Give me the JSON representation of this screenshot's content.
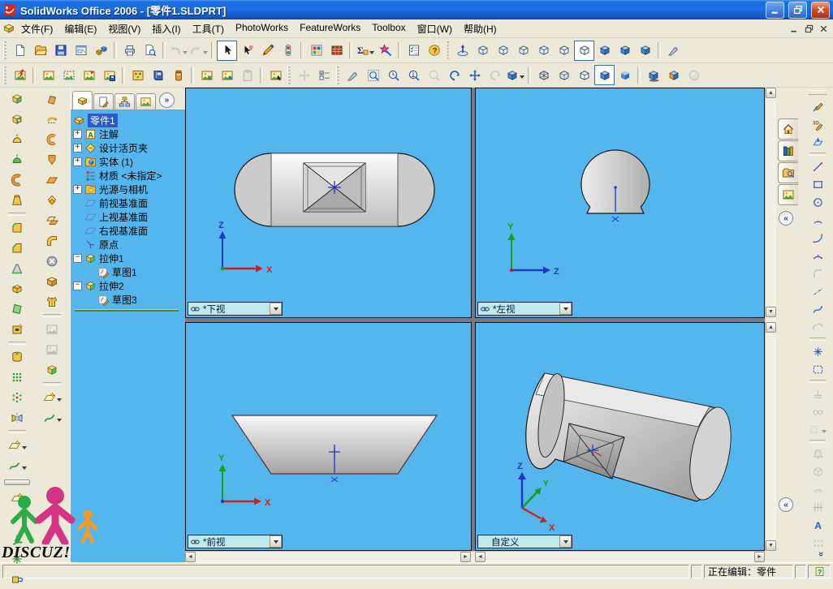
{
  "colors": {
    "viewport_bg": "#55b6ee",
    "titlebar_blue": "#1b6be0",
    "toolbar_bg": "#ece9d8",
    "selection_blue": "#2a5cc8",
    "combo_bg": "#c2e8ea",
    "axis_red": "#cc2020",
    "axis_green": "#15a015",
    "axis_blue": "#2233cc"
  },
  "titlebar": {
    "title": "SolidWorks Office 2006 - [零件1.SLDPRT]"
  },
  "menubar": {
    "items": [
      {
        "id": "file",
        "label": "文件(F)"
      },
      {
        "id": "edit",
        "label": "编辑(E)"
      },
      {
        "id": "view",
        "label": "视图(V)"
      },
      {
        "id": "insert",
        "label": "插入(I)"
      },
      {
        "id": "tools",
        "label": "工具(T)"
      },
      {
        "id": "photoworks",
        "label": "PhotoWorks"
      },
      {
        "id": "featureworks",
        "label": "FeatureWorks"
      },
      {
        "id": "toolbox",
        "label": "Toolbox"
      },
      {
        "id": "window",
        "label": "窗口(W)"
      },
      {
        "id": "help",
        "label": "帮助(H)"
      }
    ]
  },
  "toolbar_row1": [
    {
      "grip": true
    },
    {
      "id": "new-document",
      "g": "page"
    },
    {
      "id": "open-document",
      "g": "folder"
    },
    {
      "id": "save",
      "g": "floppy"
    },
    {
      "id": "make-drawing-from-part",
      "g": "drawing"
    },
    {
      "id": "make-assembly-from-part",
      "g": "assembly"
    },
    {
      "sep": true
    },
    {
      "id": "print",
      "g": "printer"
    },
    {
      "id": "print-preview",
      "g": "preview"
    },
    {
      "sep": true
    },
    {
      "id": "undo",
      "g": "undo",
      "dd": true,
      "disabled": true
    },
    {
      "id": "redo",
      "g": "redo",
      "dd": true,
      "disabled": true
    },
    {
      "sep": true
    },
    {
      "id": "select",
      "g": "cursor",
      "active": true
    },
    {
      "id": "select-other",
      "g": "cursor2"
    },
    {
      "id": "sketch-toggle",
      "g": "pencil"
    },
    {
      "id": "rebuild",
      "g": "traffic"
    },
    {
      "sep": true
    },
    {
      "id": "edit-color",
      "g": "palette"
    },
    {
      "id": "edit-texture",
      "g": "bricks"
    },
    {
      "sep": true
    },
    {
      "id": "design-table",
      "g": "sigma",
      "dd": true
    },
    {
      "id": "photoworks-wizard",
      "g": "wizard"
    },
    {
      "sep": true
    },
    {
      "id": "options",
      "g": "checklist"
    },
    {
      "id": "help",
      "g": "help"
    },
    {
      "grip": true
    },
    {
      "id": "normal-to",
      "g": "normalto"
    },
    {
      "id": "front-view",
      "g": "cubew"
    },
    {
      "id": "back-view",
      "g": "cubew"
    },
    {
      "id": "left-view",
      "g": "cubew"
    },
    {
      "id": "right-view",
      "g": "cubew"
    },
    {
      "id": "top-view",
      "g": "cubew"
    },
    {
      "id": "bottom-view",
      "g": "cubew",
      "active": true
    },
    {
      "id": "isometric-view",
      "g": "cubes"
    },
    {
      "id": "trimetric-view",
      "g": "cubes"
    },
    {
      "id": "dimetric-view",
      "g": "cubes"
    },
    {
      "sep": true
    },
    {
      "id": "measure",
      "g": "probe"
    }
  ],
  "toolbar_row2": [
    {
      "grip": true
    },
    {
      "id": "photoworks-render",
      "g": "render"
    },
    {
      "sep": true
    },
    {
      "id": "render-area",
      "g": "photo"
    },
    {
      "id": "render-selection",
      "g": "photodash"
    },
    {
      "id": "render-last",
      "g": "photoarrow"
    },
    {
      "id": "render-to-file",
      "g": "photosave"
    },
    {
      "sep": true
    },
    {
      "id": "scene-editor",
      "g": "scene"
    },
    {
      "id": "material-editor",
      "g": "book"
    },
    {
      "id": "texture-editor",
      "g": "jar"
    },
    {
      "sep": true
    },
    {
      "id": "copy-render-settings",
      "g": "photocut"
    },
    {
      "id": "duplicate-render",
      "g": "photoplus"
    },
    {
      "id": "paste-render-settings",
      "g": "paste",
      "disabled": true
    },
    {
      "sep": true
    },
    {
      "id": "photoworks-options",
      "g": "photocursor"
    },
    {
      "grip": true
    },
    {
      "id": "motion-trace",
      "g": "grayarrows",
      "disabled": true
    },
    {
      "id": "animation-options",
      "g": "animopts"
    },
    {
      "grip": true
    },
    {
      "id": "reference-probe",
      "g": "probe"
    },
    {
      "id": "zoom-to-fit",
      "g": "zoomfit"
    },
    {
      "id": "zoom-to-area",
      "g": "zoomwin"
    },
    {
      "id": "zoom-in-out",
      "g": "zoomio"
    },
    {
      "id": "zoom-to-selection",
      "g": "zoomsel",
      "disabled": true
    },
    {
      "id": "rotate-view",
      "g": "rotview"
    },
    {
      "id": "pan",
      "g": "pan"
    },
    {
      "id": "rotate-about-scene-floor",
      "g": "rotgray",
      "disabled": true
    },
    {
      "id": "view-orientation",
      "g": "cubes",
      "dd": true
    },
    {
      "sep": true
    },
    {
      "id": "wireframe",
      "g": "dwire"
    },
    {
      "id": "hidden-lines-visible",
      "g": "dhlv"
    },
    {
      "id": "hidden-lines-removed",
      "g": "dhlr"
    },
    {
      "id": "shaded-with-edges",
      "g": "dse",
      "active": true
    },
    {
      "id": "shaded",
      "g": "dsh"
    },
    {
      "sep": true
    },
    {
      "id": "shadows-in-shaded-mode",
      "g": "dshadow"
    },
    {
      "id": "section-view",
      "g": "dsection"
    },
    {
      "id": "realview",
      "g": "sphere",
      "disabled": true
    }
  ],
  "left_toolbar_features": [
    {
      "id": "extruded-boss",
      "g": "fext"
    },
    {
      "id": "extruded-cut",
      "g": "fcut"
    },
    {
      "id": "revolved-boss",
      "g": "frev"
    },
    {
      "id": "revolved-cut",
      "g": "frevg"
    },
    {
      "id": "swept-boss",
      "g": "fsweep"
    },
    {
      "id": "lofted-boss",
      "g": "floft"
    },
    {
      "sep": true
    },
    {
      "id": "fillet",
      "g": "ffillet"
    },
    {
      "id": "chamfer",
      "g": "fchamfer"
    },
    {
      "id": "rib",
      "g": "frib"
    },
    {
      "id": "shell",
      "g": "fshell"
    },
    {
      "id": "draft",
      "g": "fdraft"
    },
    {
      "id": "hole-wizard",
      "g": "fhole"
    },
    {
      "sep": true
    },
    {
      "id": "wrap",
      "g": "fwrap"
    },
    {
      "id": "linear-pattern",
      "g": "fpat"
    },
    {
      "id": "circular-pattern",
      "g": "fcpat"
    },
    {
      "id": "mirror",
      "g": "fmirror"
    },
    {
      "sep": true
    },
    {
      "id": "reference-geometry",
      "g": "fplane",
      "dd": true
    },
    {
      "id": "curves",
      "g": "fcurve",
      "dd": true
    }
  ],
  "left_toolbar_surfaces": [
    {
      "id": "extruded-surface",
      "g": "sext"
    },
    {
      "id": "revolved-surface",
      "g": "srev"
    },
    {
      "id": "swept-surface",
      "g": "ssweep"
    },
    {
      "id": "lofted-surface",
      "g": "sloft"
    },
    {
      "id": "planar-surface",
      "g": "splanar"
    },
    {
      "id": "offset-surface",
      "g": "soffset"
    },
    {
      "id": "mid-surface",
      "g": "smid"
    },
    {
      "id": "filled-surface",
      "g": "selbow"
    },
    {
      "id": "delete-face",
      "g": "sdelface"
    },
    {
      "id": "untrim-surface",
      "g": "suntrim"
    },
    {
      "id": "thicken",
      "g": "svest"
    },
    {
      "sep": true
    },
    {
      "id": "extend-surface",
      "g": "photo",
      "disabled": true
    },
    {
      "id": "trim-surface",
      "g": "photo",
      "disabled": true
    },
    {
      "id": "replace-face",
      "g": "fext"
    },
    {
      "sep": true
    },
    {
      "id": "surface-reference-geometry",
      "g": "fplane",
      "dd": true
    },
    {
      "id": "surface-curves",
      "g": "fcurve",
      "dd": true
    }
  ],
  "left_toolbar_reference": [
    {
      "id": "reference-plane",
      "g": "fplane"
    },
    {
      "id": "reference-axis",
      "g": "faxis"
    },
    {
      "id": "coordinate-system",
      "g": "fcoord"
    },
    {
      "id": "reference-point",
      "g": "fpoint"
    },
    {
      "id": "mate-reference",
      "g": "fmate"
    }
  ],
  "feature_tree": {
    "tabs": [
      {
        "id": "featuremanager",
        "g": "tpart",
        "active": true
      },
      {
        "id": "propertymanager",
        "g": "propmgr"
      },
      {
        "id": "configurationmanager",
        "g": "cfgmgr"
      },
      {
        "id": "photoworks-items",
        "g": "photo"
      }
    ],
    "overflow_glyph": "»",
    "root_label": "零件1",
    "items": [
      {
        "id": "annotations",
        "label": "注解",
        "icon": "tann",
        "exp": "+",
        "lvl": 1
      },
      {
        "id": "design-binder",
        "label": "设计活页夹",
        "icon": "tbinder",
        "exp": "+",
        "lvl": 1
      },
      {
        "id": "solid-bodies",
        "label": "实体 (1)",
        "icon": "tsolids",
        "exp": "+",
        "lvl": 1
      },
      {
        "id": "material",
        "label": "材质 <未指定>",
        "icon": "tmat",
        "exp": "",
        "lvl": 1
      },
      {
        "id": "lights-cameras",
        "label": "光源与相机",
        "icon": "tlights",
        "exp": "+",
        "lvl": 1
      },
      {
        "id": "front-plane",
        "label": "前视基准面",
        "icon": "tplane",
        "exp": "",
        "lvl": 1
      },
      {
        "id": "top-plane",
        "label": "上视基准面",
        "icon": "tplane",
        "exp": "",
        "lvl": 1
      },
      {
        "id": "right-plane",
        "label": "右视基准面",
        "icon": "tplane",
        "exp": "",
        "lvl": 1
      },
      {
        "id": "origin",
        "label": "原点",
        "icon": "torigin",
        "exp": "",
        "lvl": 1
      },
      {
        "id": "extrude1",
        "label": "拉伸1",
        "icon": "fext",
        "exp": "-",
        "lvl": 1
      },
      {
        "id": "sketch1",
        "label": "草图1",
        "icon": "tsketch",
        "exp": "",
        "lvl": 2
      },
      {
        "id": "extrude2",
        "label": "拉伸2",
        "icon": "fext",
        "exp": "-",
        "lvl": 1
      },
      {
        "id": "sketch3",
        "label": "草图3",
        "icon": "tsketch",
        "exp": "",
        "lvl": 2
      }
    ]
  },
  "viewports": {
    "top_left": {
      "label": "*下视",
      "linked": true,
      "triad": {
        "up": "Z",
        "right": "X"
      }
    },
    "top_right": {
      "label": "*左视",
      "linked": true,
      "triad": {
        "up": "Y",
        "right": "Z"
      }
    },
    "bottom_left": {
      "label": "*前视",
      "linked": true,
      "triad": {
        "up": "Y",
        "right": "X"
      }
    },
    "bottom_right": {
      "label": "自定义",
      "linked": false,
      "triad": {
        "up": "Z",
        "mid": "Y",
        "right": "X"
      }
    }
  },
  "taskpane": {
    "tabs": [
      {
        "id": "solidworks-resources",
        "g": "home"
      },
      {
        "id": "design-library",
        "g": "library"
      },
      {
        "id": "file-explorer",
        "g": "folderfind"
      },
      {
        "id": "photoworks-items-pane",
        "g": "photo"
      }
    ],
    "collapse_glyph": "«",
    "more_glyph": "»"
  },
  "sketch_toolbar": [
    {
      "id": "sketch",
      "g": "skpencil"
    },
    {
      "id": "3d-sketch",
      "g": "sk3d"
    },
    {
      "id": "modify-sketch",
      "g": "skmod"
    },
    {
      "sep": true
    },
    {
      "id": "line",
      "g": "skline"
    },
    {
      "id": "rectangle",
      "g": "skrect"
    },
    {
      "id": "circle",
      "g": "skcircle"
    },
    {
      "id": "centerpoint-arc",
      "g": "skarc1"
    },
    {
      "id": "tangent-arc",
      "g": "skarc2"
    },
    {
      "id": "3-point-arc",
      "g": "skarc3"
    },
    {
      "id": "sketch-fillet",
      "g": "skfillet",
      "disabled": true
    },
    {
      "id": "centerline",
      "g": "skcl"
    },
    {
      "id": "spline",
      "g": "skspline"
    },
    {
      "id": "partial-ellipse",
      "g": "skellipse",
      "disabled": true
    },
    {
      "sep": true
    },
    {
      "id": "point",
      "g": "skpoint"
    },
    {
      "id": "selection-box",
      "g": "skselbox"
    },
    {
      "sep": true
    },
    {
      "id": "add-relation",
      "g": "skrel",
      "disabled": true
    },
    {
      "id": "display-relations",
      "g": "skglasses",
      "disabled": true
    },
    {
      "id": "relation-scan",
      "g": "skreldd",
      "disabled": true,
      "dd": true
    },
    {
      "sep": true
    },
    {
      "id": "check-sketch",
      "g": "skbell",
      "disabled": true
    },
    {
      "id": "convert-entities",
      "g": "skconv",
      "disabled": true
    },
    {
      "id": "offset-entities",
      "g": "skoffset",
      "disabled": true
    },
    {
      "id": "trim-entities",
      "g": "sktrim",
      "disabled": true
    },
    {
      "id": "sketch-text",
      "g": "sktext"
    },
    {
      "id": "linear-sketch-pattern",
      "g": "skpat",
      "disabled": true
    }
  ],
  "statusbar": {
    "editing_label": "正在编辑：零件"
  },
  "watermark": {
    "text": "DISCUZ!"
  }
}
